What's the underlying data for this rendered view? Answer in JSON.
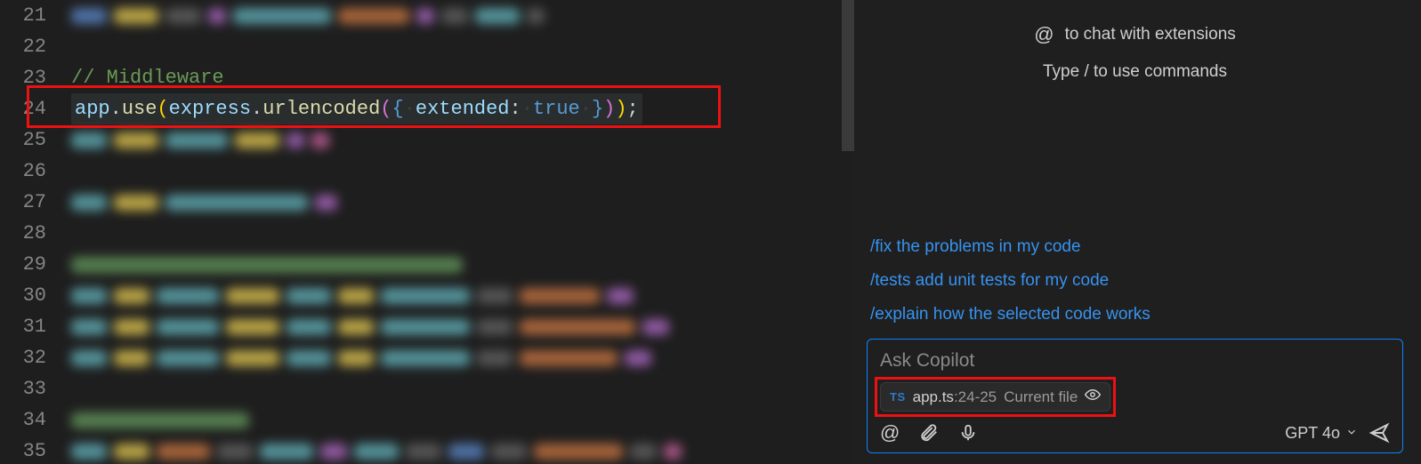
{
  "editor": {
    "lines": [
      "21",
      "22",
      "23",
      "24",
      "25",
      "26",
      "27",
      "28",
      "29",
      "30",
      "31",
      "32",
      "33",
      "34",
      "35"
    ],
    "comment": "// Middleware",
    "code24": {
      "p1": "app",
      "p2": "use",
      "p3": "express",
      "p4": "urlencoded",
      "p5": "extended",
      "p6": "true"
    }
  },
  "chat": {
    "hint_at": "to chat with extensions",
    "hint_slash": "Type / to use commands",
    "suggestions": [
      "/fix the problems in my code",
      "/tests add unit tests for my code",
      "/explain how the selected code works"
    ],
    "placeholder": "Ask Copilot",
    "context": {
      "lang": "TS",
      "file": "app.ts",
      "range": ":24-25",
      "scope": "Current file"
    },
    "model": "GPT 4o"
  }
}
